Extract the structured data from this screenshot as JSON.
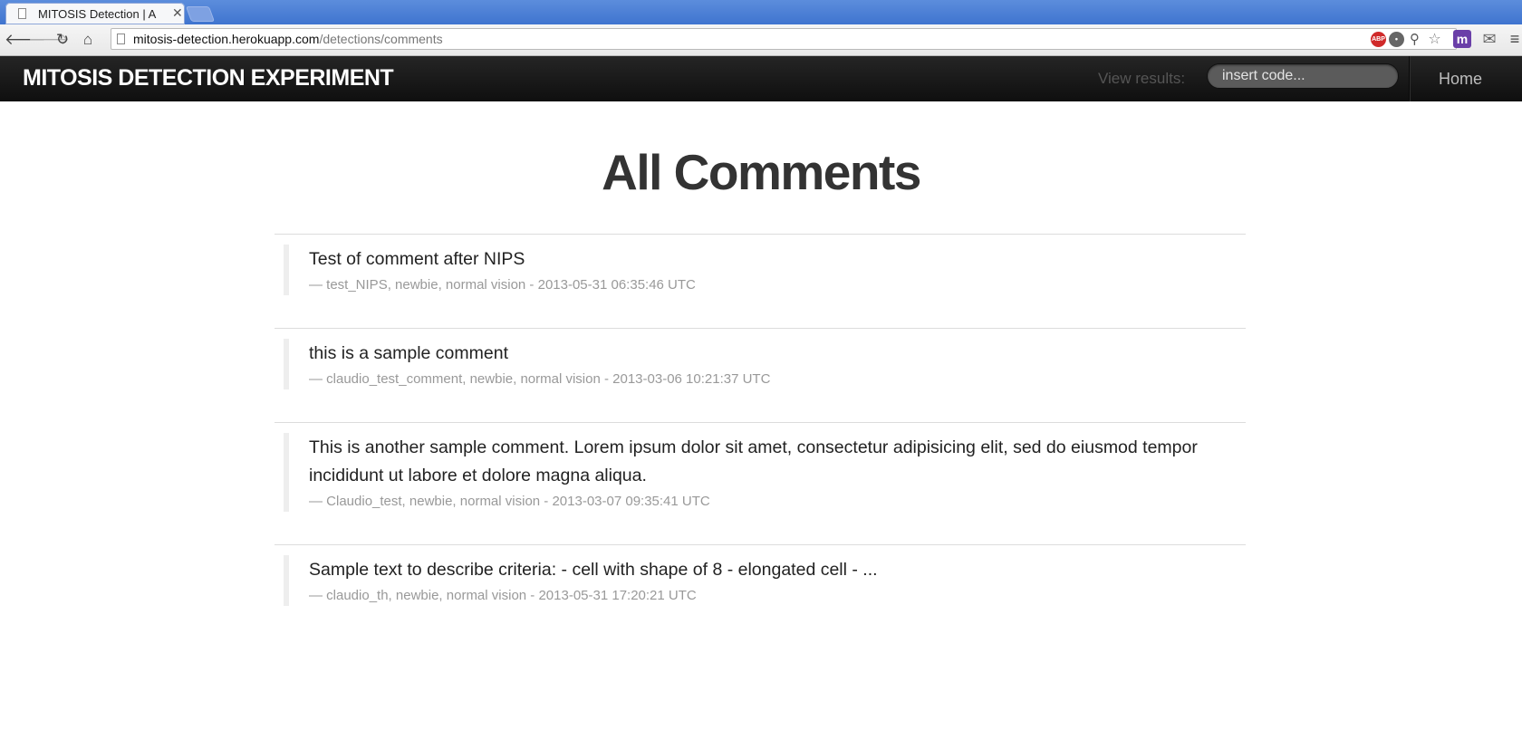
{
  "browser": {
    "tab_title": "MITOSIS Detection | A",
    "url_host": "mitosis-detection.herokuapp.com",
    "url_path": "/detections/comments"
  },
  "navbar": {
    "brand": "MITOSIS DETECTION EXPERIMENT",
    "view_results_label": "View results:",
    "code_placeholder": "insert code...",
    "home_link": "Home"
  },
  "main": {
    "title": "All Comments",
    "comments": [
      {
        "text": "Test of comment after NIPS",
        "meta": "— test_NIPS, newbie, normal vision - 2013-05-31 06:35:46 UTC"
      },
      {
        "text": "this is a sample comment",
        "meta": "— claudio_test_comment, newbie, normal vision - 2013-03-06 10:21:37 UTC"
      },
      {
        "text": "This is another sample comment. Lorem ipsum dolor sit amet, consectetur adipisicing elit, sed do eiusmod tempor incididunt ut labore et dolore magna aliqua.",
        "meta": "— Claudio_test, newbie, normal vision - 2013-03-07 09:35:41 UTC"
      },
      {
        "text": "Sample text to describe criteria: - cell with shape of 8 - elongated cell - ...",
        "meta": "— claudio_th, newbie, normal vision - 2013-05-31 17:20:21 UTC"
      }
    ]
  }
}
